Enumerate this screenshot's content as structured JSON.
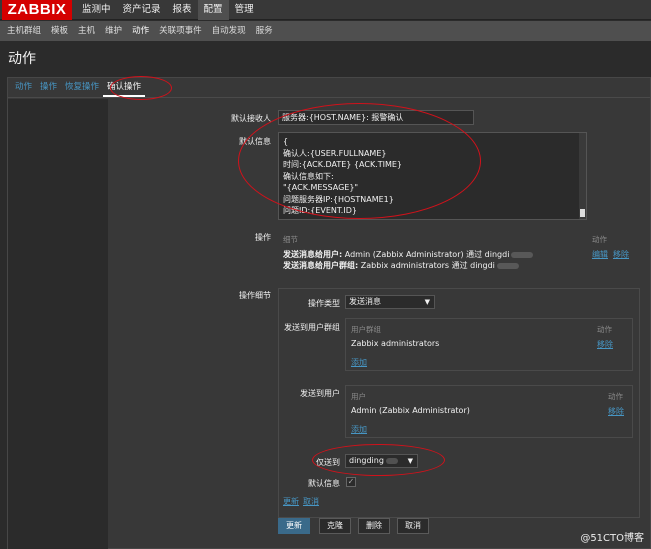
{
  "app": {
    "logo": "ZABBIX",
    "main_nav": [
      "监测中",
      "资产记录",
      "报表",
      "配置",
      "管理"
    ],
    "sub_nav": [
      "主机群组",
      "模板",
      "主机",
      "维护",
      "动作",
      "关联项事件",
      "自动发现",
      "服务"
    ]
  },
  "page": {
    "title": "动作"
  },
  "tabs": [
    "动作",
    "操作",
    "恢复操作",
    "确认操作"
  ],
  "form": {
    "default_subject_label": "默认接收人",
    "default_subject_value": "服务器:{HOST.NAME}: 报警确认",
    "default_message_label": "默认信息",
    "default_message_lines": [
      "{",
      "确认人:{USER.FULLNAME}",
      "时间:{ACK.DATE}  {ACK.TIME}",
      "确认信息如下:",
      "\"{ACK.MESSAGE}\"",
      "问题服务器IP:{HOSTNAME1}",
      "问题ID:{EVENT.ID}"
    ],
    "operations_label": "操作",
    "operations_header_details": "细节",
    "operations_header_action": "动作",
    "operations_row1_prefix": "发送消息给用户:",
    "operations_row1_text": " Admin (Zabbix Administrator) 通过 dingdi",
    "operations_row2_prefix": "发送消息给用户群组:",
    "operations_row2_text": " Zabbix administrators 通过 dingdi",
    "operations_edit": "编辑",
    "operations_remove": "移除",
    "op_details_label": "操作细节",
    "op_type_label": "操作类型",
    "op_type_value": "发送消息",
    "send_to_groups_label": "发送到用户群组",
    "groups_header": "用户群组",
    "groups_action_header": "动作",
    "group_name": "Zabbix administrators",
    "group_remove": "移除",
    "group_add": "添加",
    "send_to_users_label": "发送到用户",
    "users_header": "用户",
    "users_action_header": "动作",
    "user_name": "Admin (Zabbix Administrator)",
    "user_remove": "移除",
    "user_add": "添加",
    "send_only_to_label": "仅送到",
    "send_only_to_value": "dingding",
    "default_message_check_label": "默认信息",
    "default_message_checked": "✓",
    "update_link": "更新",
    "cancel_link": "取消"
  },
  "buttons": {
    "update": "更新",
    "clone": "克隆",
    "delete": "删除",
    "cancel": "取消"
  },
  "watermark": "@51CTO博客"
}
